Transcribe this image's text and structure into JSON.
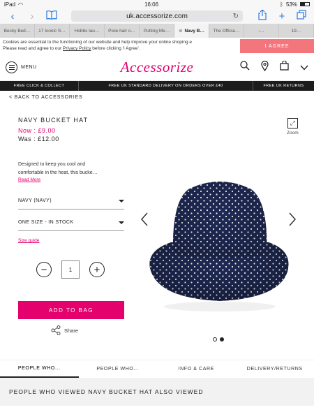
{
  "status_bar": {
    "device": "iPad",
    "time": "16:06",
    "battery": "53%",
    "battery_level": 0.53
  },
  "browser": {
    "url": "uk.accessorize.com",
    "tabs": [
      {
        "label": "Becky Bed…",
        "active": false
      },
      {
        "label": "17 Iconic S…",
        "active": false
      },
      {
        "label": "Hobbs lau…",
        "active": false
      },
      {
        "label": "Pixie hair o…",
        "active": false
      },
      {
        "label": "Putting Me…",
        "active": false
      },
      {
        "label": "Navy B…",
        "active": true
      },
      {
        "label": "The Officia…",
        "active": false
      },
      {
        "label": "-…",
        "active": false
      },
      {
        "label": "19…",
        "active": false
      }
    ]
  },
  "cookie_banner": {
    "line1": "Cookies are essential to the functioning of our website and help improve your online shoping e",
    "line2_pre": "Please read and agree to our ",
    "line2_link": "Privacy Policy",
    "line2_post": " before clicking 'I Agree'.",
    "agree_label": "I AGREE"
  },
  "header": {
    "menu_label": "MENU",
    "logo": "Accessorize",
    "brand_color": "#e4006d"
  },
  "promo_bar": [
    "FREE CLICK & COLLECT",
    "FREE UK STANDARD DELIVERY ON ORDERS OVER £40",
    "FREE UK RETURNS"
  ],
  "back_link": "< BACK TO ACCESSORIES",
  "product": {
    "title": "NAVY BUCKET HAT",
    "now_price": "Now :  £9.00",
    "was_price": "Was :  £12.00",
    "description_l1": "Designed to keep you cool and",
    "description_l2": "comfortable in the heat, this bucke…",
    "read_more": "Read More",
    "colour_select": "NAVY (NAVY)",
    "size_select": "ONE SIZE - IN STOCK",
    "size_guide": "Size guide",
    "quantity": "1",
    "add_to_bag": "ADD TO BAG",
    "share": "Share",
    "zoom": "Zoom"
  },
  "bottom_tabs": [
    "PEOPLE WHO...",
    "PEOPLE WHO...",
    "INFO & CARE",
    "DELIVERY/RETURNS"
  ],
  "also_viewed": "PEOPLE WHO VIEWED NAVY BUCKET HAT ALSO VIEWED"
}
